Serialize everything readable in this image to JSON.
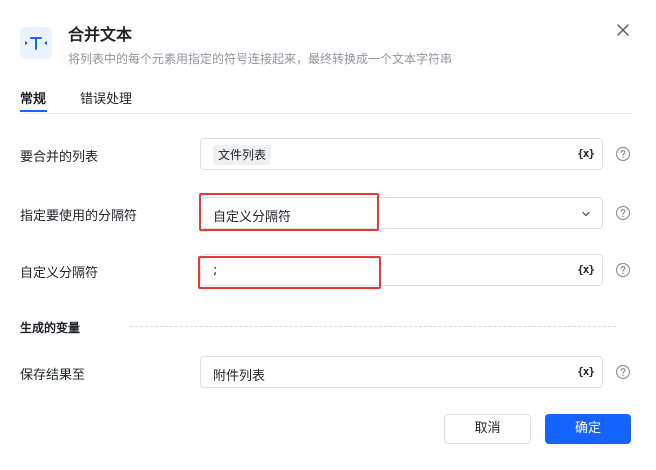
{
  "dialog": {
    "title": "合并文本",
    "subtitle": "将列表中的每个元素用指定的符号连接起来，最终转换成一个文本字符串",
    "icon": "text-merge-icon"
  },
  "tabs": [
    {
      "label": "常规",
      "active": true
    },
    {
      "label": "错误处理",
      "active": false
    }
  ],
  "form": {
    "list": {
      "label": "要合并的列表",
      "value_tag": "文件列表",
      "var_label": "{x}"
    },
    "separator_type": {
      "label": "指定要使用的分隔符",
      "value": "自定义分隔符"
    },
    "custom_separator": {
      "label": "自定义分隔符",
      "value": ";",
      "var_label": "{x}"
    }
  },
  "output_section": {
    "title": "生成的变量",
    "save_to": {
      "label": "保存结果至",
      "value": "附件列表",
      "var_label": "{x}"
    }
  },
  "buttons": {
    "cancel": "取消",
    "ok": "确定"
  },
  "colors": {
    "primary": "#1664ff",
    "highlight": "#e53935"
  }
}
